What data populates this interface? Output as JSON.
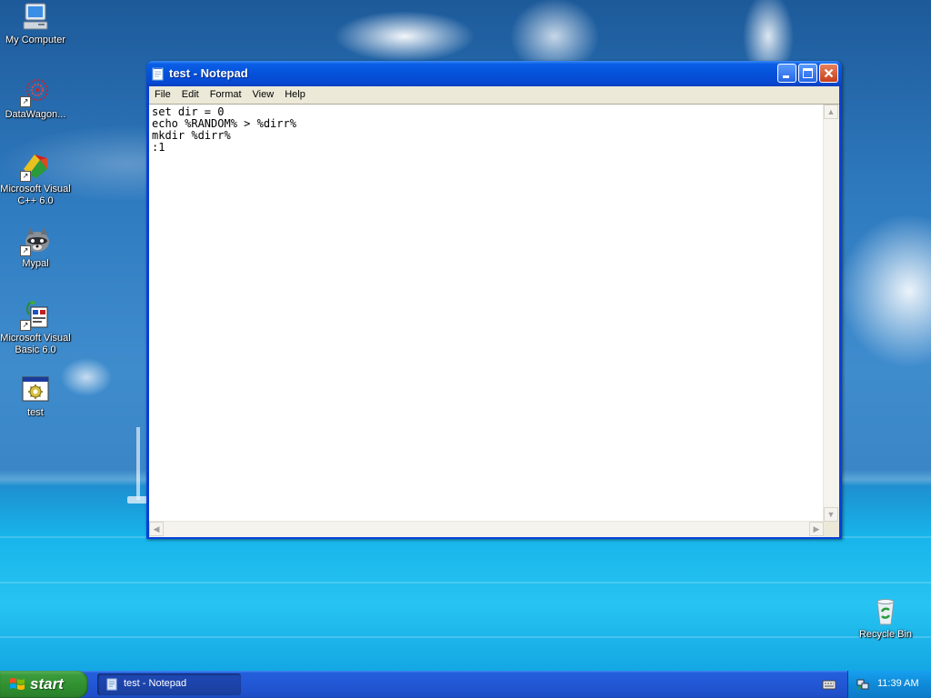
{
  "desktop": {
    "icons": [
      {
        "label": "My Computer"
      },
      {
        "label": "DataWagon..."
      },
      {
        "label": "Microsoft Visual C++ 6.0"
      },
      {
        "label": "Mypal"
      },
      {
        "label": "Microsoft Visual Basic 6.0"
      },
      {
        "label": "test"
      }
    ],
    "recycle_bin": {
      "label": "Recycle Bin"
    }
  },
  "notepad": {
    "title": "test - Notepad",
    "menu": [
      "File",
      "Edit",
      "Format",
      "View",
      "Help"
    ],
    "content": "set dir = 0\necho %RANDOM% > %dirr%\nmkdir %dirr%\n:1"
  },
  "taskbar": {
    "start_label": "start",
    "tasks": [
      {
        "label": "test - Notepad"
      }
    ],
    "clock": "11:39 AM"
  },
  "colors": {
    "titlebar_blue": "#0551d9",
    "taskbar_blue": "#245edb",
    "start_green": "#3c9b3c",
    "tray_blue": "#0f8ad8",
    "close_red": "#c8401c"
  }
}
